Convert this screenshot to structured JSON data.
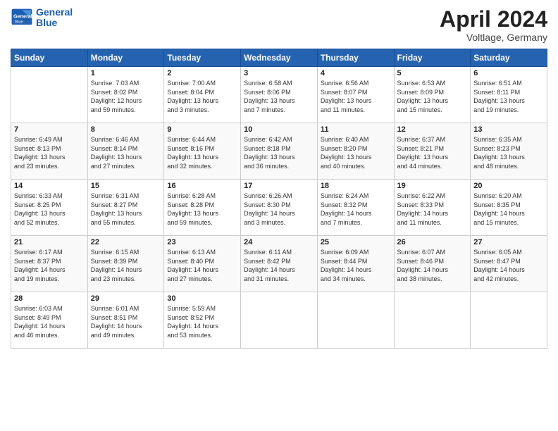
{
  "header": {
    "logo_line1": "General",
    "logo_line2": "Blue",
    "month": "April 2024",
    "location": "Voltlage, Germany"
  },
  "days_of_week": [
    "Sunday",
    "Monday",
    "Tuesday",
    "Wednesday",
    "Thursday",
    "Friday",
    "Saturday"
  ],
  "weeks": [
    [
      {
        "day": "",
        "sunrise": "",
        "sunset": "",
        "daylight": ""
      },
      {
        "day": "1",
        "sunrise": "Sunrise: 7:03 AM",
        "sunset": "Sunset: 8:02 PM",
        "daylight": "Daylight: 12 hours and 59 minutes."
      },
      {
        "day": "2",
        "sunrise": "Sunrise: 7:00 AM",
        "sunset": "Sunset: 8:04 PM",
        "daylight": "Daylight: 13 hours and 3 minutes."
      },
      {
        "day": "3",
        "sunrise": "Sunrise: 6:58 AM",
        "sunset": "Sunset: 8:06 PM",
        "daylight": "Daylight: 13 hours and 7 minutes."
      },
      {
        "day": "4",
        "sunrise": "Sunrise: 6:56 AM",
        "sunset": "Sunset: 8:07 PM",
        "daylight": "Daylight: 13 hours and 11 minutes."
      },
      {
        "day": "5",
        "sunrise": "Sunrise: 6:53 AM",
        "sunset": "Sunset: 8:09 PM",
        "daylight": "Daylight: 13 hours and 15 minutes."
      },
      {
        "day": "6",
        "sunrise": "Sunrise: 6:51 AM",
        "sunset": "Sunset: 8:11 PM",
        "daylight": "Daylight: 13 hours and 19 minutes."
      }
    ],
    [
      {
        "day": "7",
        "sunrise": "Sunrise: 6:49 AM",
        "sunset": "Sunset: 8:13 PM",
        "daylight": "Daylight: 13 hours and 23 minutes."
      },
      {
        "day": "8",
        "sunrise": "Sunrise: 6:46 AM",
        "sunset": "Sunset: 8:14 PM",
        "daylight": "Daylight: 13 hours and 27 minutes."
      },
      {
        "day": "9",
        "sunrise": "Sunrise: 6:44 AM",
        "sunset": "Sunset: 8:16 PM",
        "daylight": "Daylight: 13 hours and 32 minutes."
      },
      {
        "day": "10",
        "sunrise": "Sunrise: 6:42 AM",
        "sunset": "Sunset: 8:18 PM",
        "daylight": "Daylight: 13 hours and 36 minutes."
      },
      {
        "day": "11",
        "sunrise": "Sunrise: 6:40 AM",
        "sunset": "Sunset: 8:20 PM",
        "daylight": "Daylight: 13 hours and 40 minutes."
      },
      {
        "day": "12",
        "sunrise": "Sunrise: 6:37 AM",
        "sunset": "Sunset: 8:21 PM",
        "daylight": "Daylight: 13 hours and 44 minutes."
      },
      {
        "day": "13",
        "sunrise": "Sunrise: 6:35 AM",
        "sunset": "Sunset: 8:23 PM",
        "daylight": "Daylight: 13 hours and 48 minutes."
      }
    ],
    [
      {
        "day": "14",
        "sunrise": "Sunrise: 6:33 AM",
        "sunset": "Sunset: 8:25 PM",
        "daylight": "Daylight: 13 hours and 52 minutes."
      },
      {
        "day": "15",
        "sunrise": "Sunrise: 6:31 AM",
        "sunset": "Sunset: 8:27 PM",
        "daylight": "Daylight: 13 hours and 55 minutes."
      },
      {
        "day": "16",
        "sunrise": "Sunrise: 6:28 AM",
        "sunset": "Sunset: 8:28 PM",
        "daylight": "Daylight: 13 hours and 59 minutes."
      },
      {
        "day": "17",
        "sunrise": "Sunrise: 6:26 AM",
        "sunset": "Sunset: 8:30 PM",
        "daylight": "Daylight: 14 hours and 3 minutes."
      },
      {
        "day": "18",
        "sunrise": "Sunrise: 6:24 AM",
        "sunset": "Sunset: 8:32 PM",
        "daylight": "Daylight: 14 hours and 7 minutes."
      },
      {
        "day": "19",
        "sunrise": "Sunrise: 6:22 AM",
        "sunset": "Sunset: 8:33 PM",
        "daylight": "Daylight: 14 hours and 11 minutes."
      },
      {
        "day": "20",
        "sunrise": "Sunrise: 6:20 AM",
        "sunset": "Sunset: 8:35 PM",
        "daylight": "Daylight: 14 hours and 15 minutes."
      }
    ],
    [
      {
        "day": "21",
        "sunrise": "Sunrise: 6:17 AM",
        "sunset": "Sunset: 8:37 PM",
        "daylight": "Daylight: 14 hours and 19 minutes."
      },
      {
        "day": "22",
        "sunrise": "Sunrise: 6:15 AM",
        "sunset": "Sunset: 8:39 PM",
        "daylight": "Daylight: 14 hours and 23 minutes."
      },
      {
        "day": "23",
        "sunrise": "Sunrise: 6:13 AM",
        "sunset": "Sunset: 8:40 PM",
        "daylight": "Daylight: 14 hours and 27 minutes."
      },
      {
        "day": "24",
        "sunrise": "Sunrise: 6:11 AM",
        "sunset": "Sunset: 8:42 PM",
        "daylight": "Daylight: 14 hours and 31 minutes."
      },
      {
        "day": "25",
        "sunrise": "Sunrise: 6:09 AM",
        "sunset": "Sunset: 8:44 PM",
        "daylight": "Daylight: 14 hours and 34 minutes."
      },
      {
        "day": "26",
        "sunrise": "Sunrise: 6:07 AM",
        "sunset": "Sunset: 8:46 PM",
        "daylight": "Daylight: 14 hours and 38 minutes."
      },
      {
        "day": "27",
        "sunrise": "Sunrise: 6:05 AM",
        "sunset": "Sunset: 8:47 PM",
        "daylight": "Daylight: 14 hours and 42 minutes."
      }
    ],
    [
      {
        "day": "28",
        "sunrise": "Sunrise: 6:03 AM",
        "sunset": "Sunset: 8:49 PM",
        "daylight": "Daylight: 14 hours and 46 minutes."
      },
      {
        "day": "29",
        "sunrise": "Sunrise: 6:01 AM",
        "sunset": "Sunset: 8:51 PM",
        "daylight": "Daylight: 14 hours and 49 minutes."
      },
      {
        "day": "30",
        "sunrise": "Sunrise: 5:59 AM",
        "sunset": "Sunset: 8:52 PM",
        "daylight": "Daylight: 14 hours and 53 minutes."
      },
      {
        "day": "",
        "sunrise": "",
        "sunset": "",
        "daylight": ""
      },
      {
        "day": "",
        "sunrise": "",
        "sunset": "",
        "daylight": ""
      },
      {
        "day": "",
        "sunrise": "",
        "sunset": "",
        "daylight": ""
      },
      {
        "day": "",
        "sunrise": "",
        "sunset": "",
        "daylight": ""
      }
    ]
  ]
}
